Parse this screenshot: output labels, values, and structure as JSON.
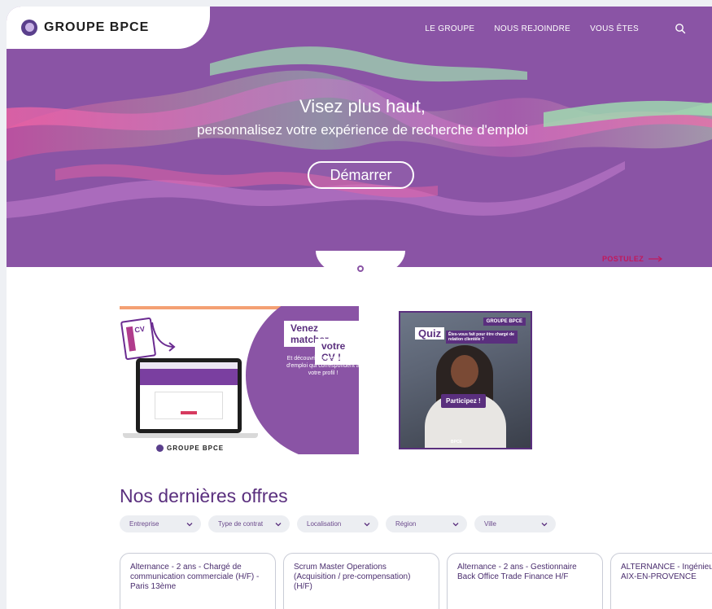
{
  "header": {
    "logo_text": "GROUPE BPCE",
    "nav": [
      "LE GROUPE",
      "NOUS REJOINDRE",
      "VOUS ÊTES"
    ],
    "search_icon": "search-icon"
  },
  "hero": {
    "title": "Visez plus haut,",
    "subtitle": "personnalisez votre expérience de recherche d'emploi",
    "cta": "Démarrer",
    "postulez": "POSTULEZ"
  },
  "banners": {
    "cv": {
      "headline_1": "Venez matcher",
      "headline_2": "votre CV !",
      "description": "Et découvrir toutes les offres d'emploi qui correspondent à votre profil !",
      "cv_label": "CV",
      "footer_logo": "GROUPE BPCE"
    },
    "quiz": {
      "tag": "GROUPE BPCE",
      "label": "Quiz",
      "question": "Êtes-vous fait pour être chargé de relation clientèle ?",
      "cta": "Participez !",
      "footer": "BPCE"
    }
  },
  "offers": {
    "title": "Nos dernières offres",
    "filters": [
      "Entreprise",
      "Type de contrat",
      "Localisation",
      "Région",
      "Ville"
    ],
    "cards": [
      "Alternance - 2 ans - Chargé de communication commerciale (H/F) - Paris 13ème",
      "Scrum Master Operations (Acquisition / pre-compensation) (H/F)",
      "Alternance - 2 ans - Gestionnaire Back Office Trade Finance H/F",
      "ALTERNANCE - Ingénieur (H/F) - AIX-EN-PROVENCE"
    ]
  },
  "colors": {
    "brand_purple": "#8a54a5",
    "dark_purple": "#5a2f7e",
    "accent_pink": "#c2185b"
  }
}
